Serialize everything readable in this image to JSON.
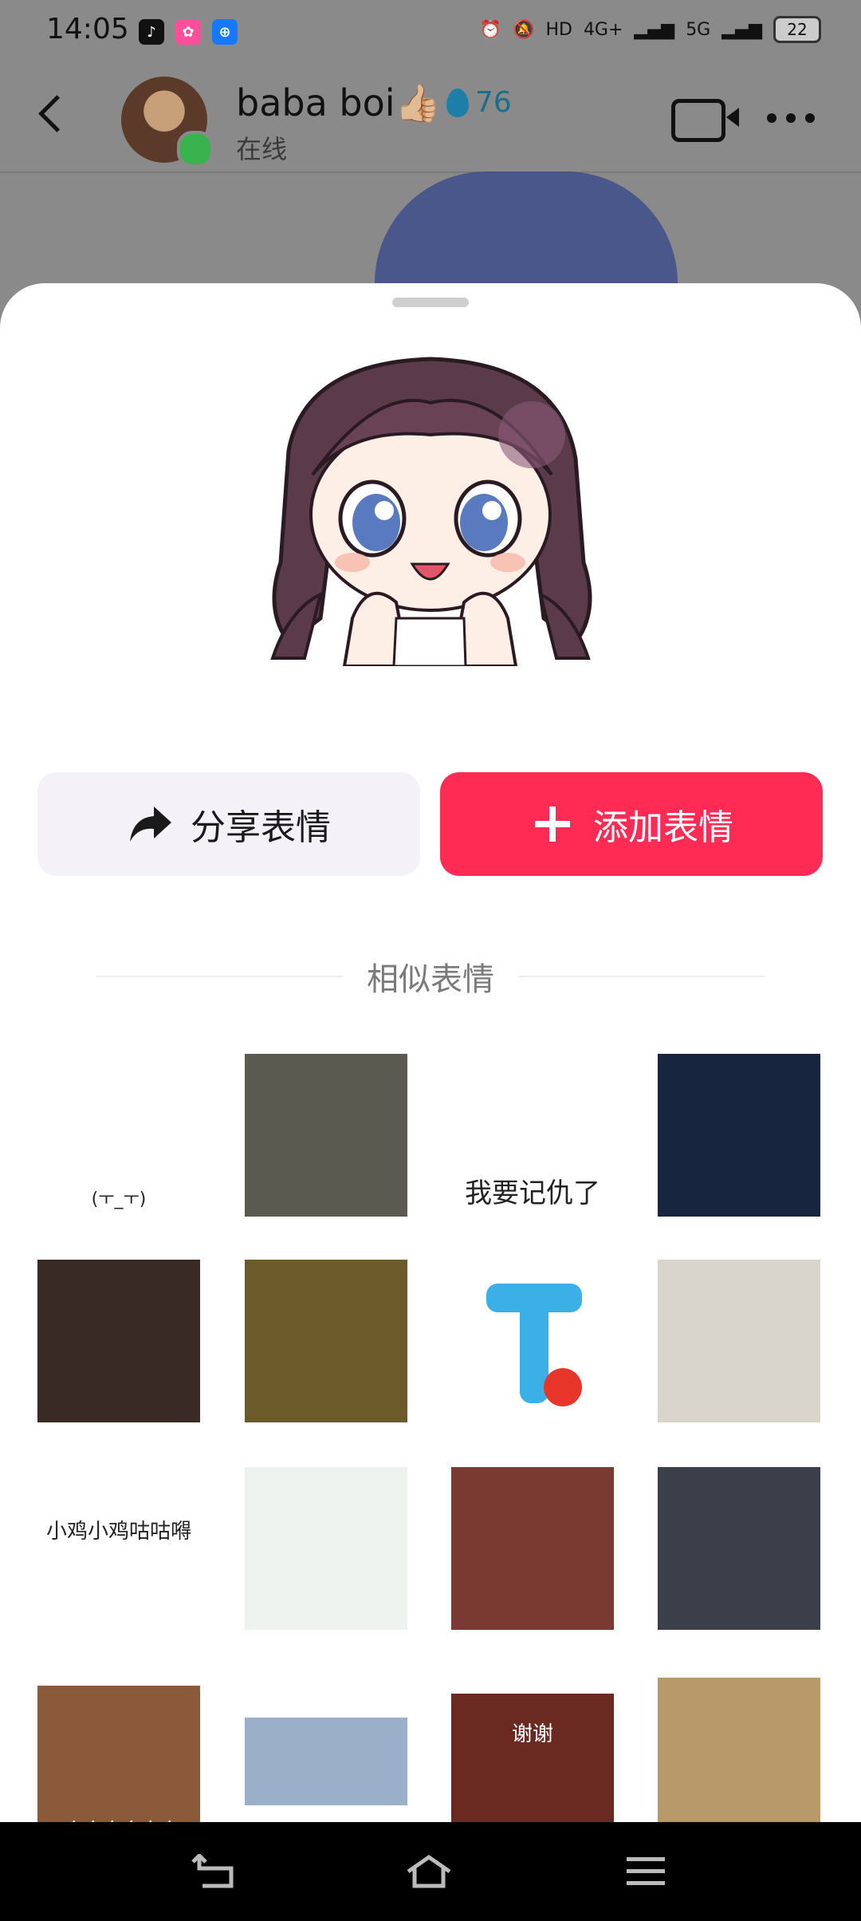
{
  "status_bar": {
    "time": "14:05",
    "hd_label": "HD",
    "network_1": "4G+",
    "network_2": "5G",
    "battery": "22"
  },
  "chat_header": {
    "contact_name": "baba boi👍🏼",
    "flame_count": "76",
    "status": "在线"
  },
  "sheet": {
    "share_label": "分享表情",
    "add_label": "添加表情",
    "similar_title": "相似表情",
    "thumbnails": [
      {
        "caption": "(ㅜ_ㅜ)",
        "bg": "#ffffff"
      },
      {
        "caption": "",
        "bg": "#5a5a50"
      },
      {
        "caption": "我要记仇了",
        "bg": "#ffffff"
      },
      {
        "caption": "",
        "bg": "#17253f"
      },
      {
        "caption": "",
        "bg": "#3a2a26"
      },
      {
        "caption": "",
        "bg": "#6b5a2a"
      },
      {
        "caption": "",
        "bg": "#ffffff"
      },
      {
        "caption": "",
        "bg": "#d9d4cc"
      },
      {
        "caption": "小鸡小鸡咕咕嘚",
        "bg": "#ffffff"
      },
      {
        "caption": "",
        "bg": "#eef2ef"
      },
      {
        "caption": "",
        "bg": "#7a3a32"
      },
      {
        "caption": "",
        "bg": "#3a3f4a"
      },
      {
        "caption": "哈哈哈哈哈哈",
        "bg": "#8a5a3a"
      },
      {
        "caption": "",
        "bg": "#9ab0c8"
      },
      {
        "caption": "谢谢",
        "bg": "#6a2a22"
      },
      {
        "caption": "",
        "bg": "#b89a6a"
      }
    ]
  },
  "colors": {
    "accent": "#fe2c55",
    "share_bg": "#f4f2f6"
  }
}
